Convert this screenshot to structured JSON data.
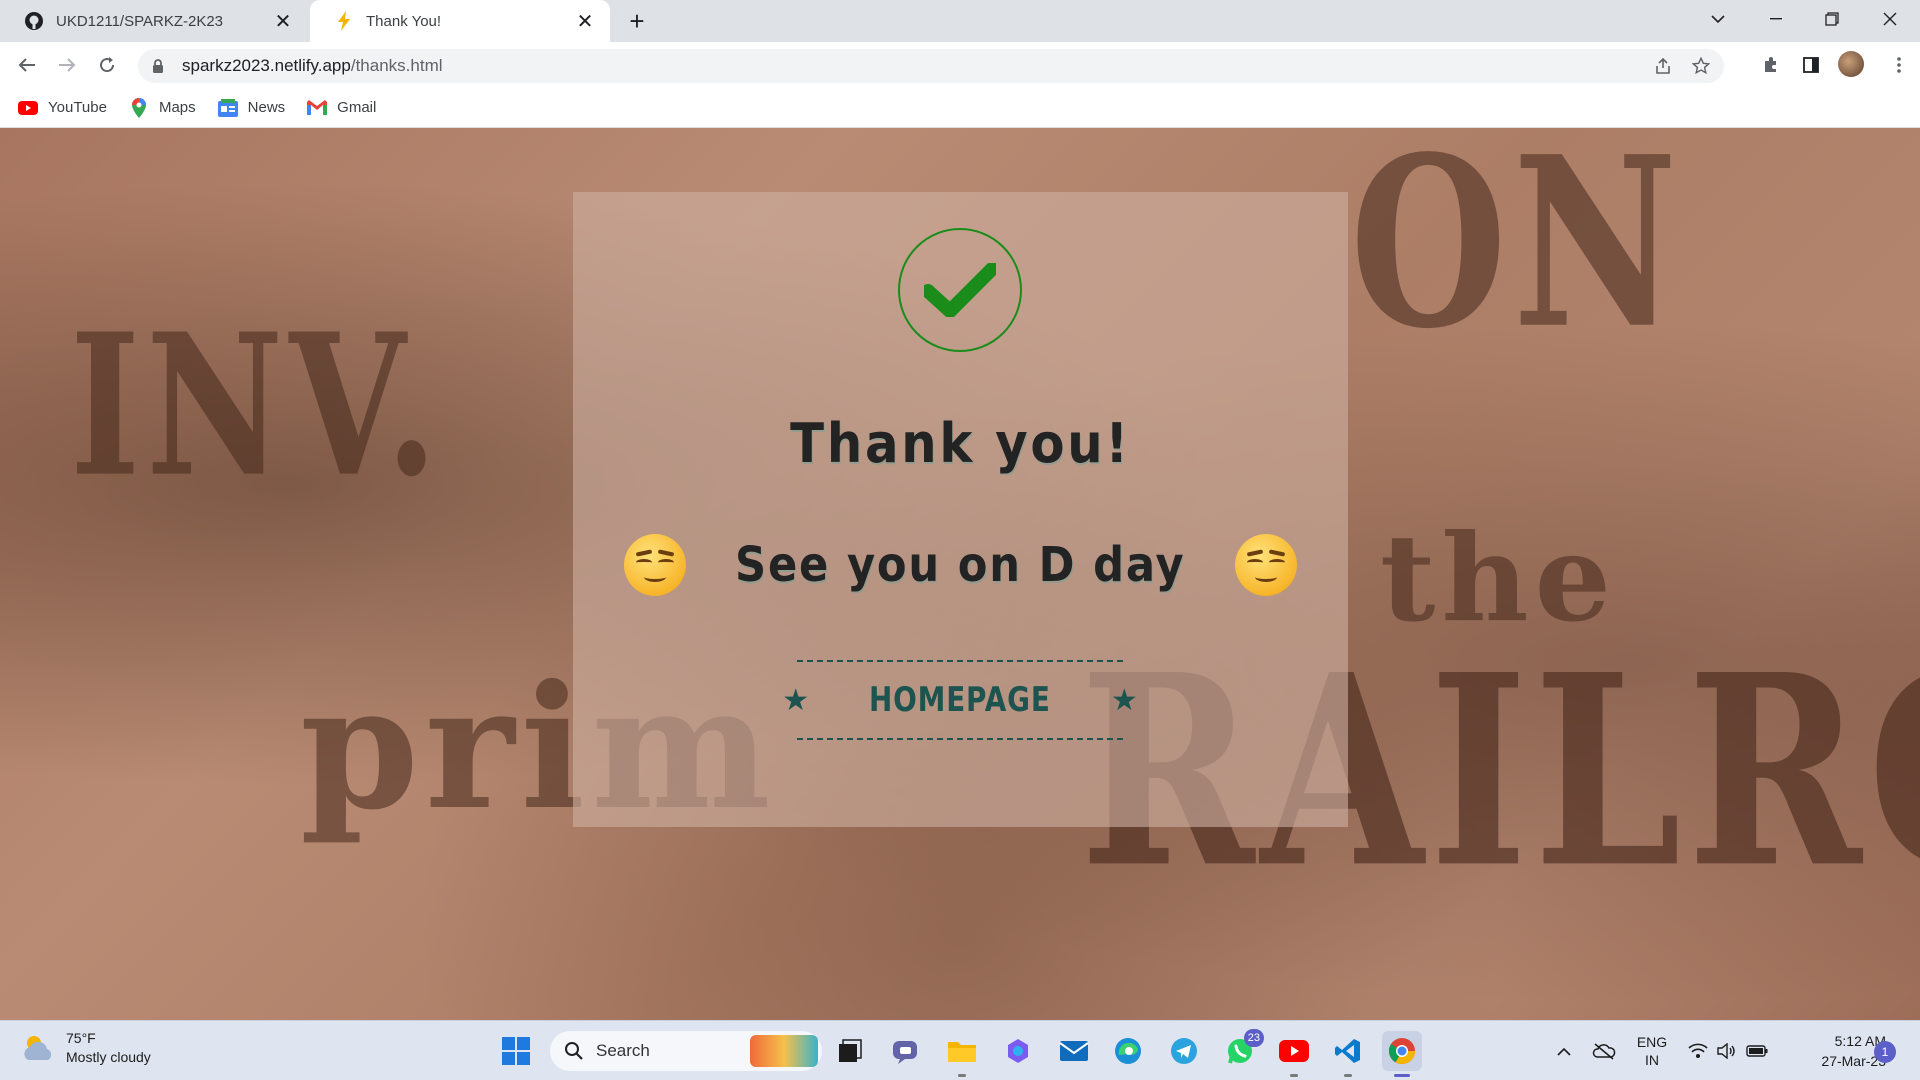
{
  "browser": {
    "tabs": [
      {
        "title": "UKD1211/SPARKZ-2K23",
        "icon": "github-icon",
        "active": false
      },
      {
        "title": "Thank You!",
        "icon": "lightning-icon",
        "active": true
      }
    ],
    "url_host": "sparkz2023.netlify.app",
    "url_path": "/thanks.html",
    "bookmarks": [
      {
        "label": "YouTube",
        "icon": "youtube-icon"
      },
      {
        "label": "Maps",
        "icon": "maps-icon"
      },
      {
        "label": "News",
        "icon": "news-icon"
      },
      {
        "label": "Gmail",
        "icon": "gmail-icon"
      }
    ]
  },
  "page": {
    "headline": "Thank you!",
    "subline": "See you on D day",
    "home_button": "HOMEPAGE",
    "background_text": [
      "INV.",
      "prim",
      "RAILROA",
      "the",
      "ON"
    ],
    "colors": {
      "check": "#1a8c1a",
      "accent": "#1e5450",
      "text": "#232323"
    }
  },
  "taskbar": {
    "weather_temp": "75°F",
    "weather_desc": "Mostly cloudy",
    "search_placeholder": "Search",
    "whatsapp_badge": "23",
    "lang_1": "ENG",
    "lang_2": "IN",
    "time": "5:12 AM",
    "date": "27-Mar-23",
    "notification_count": "1"
  }
}
